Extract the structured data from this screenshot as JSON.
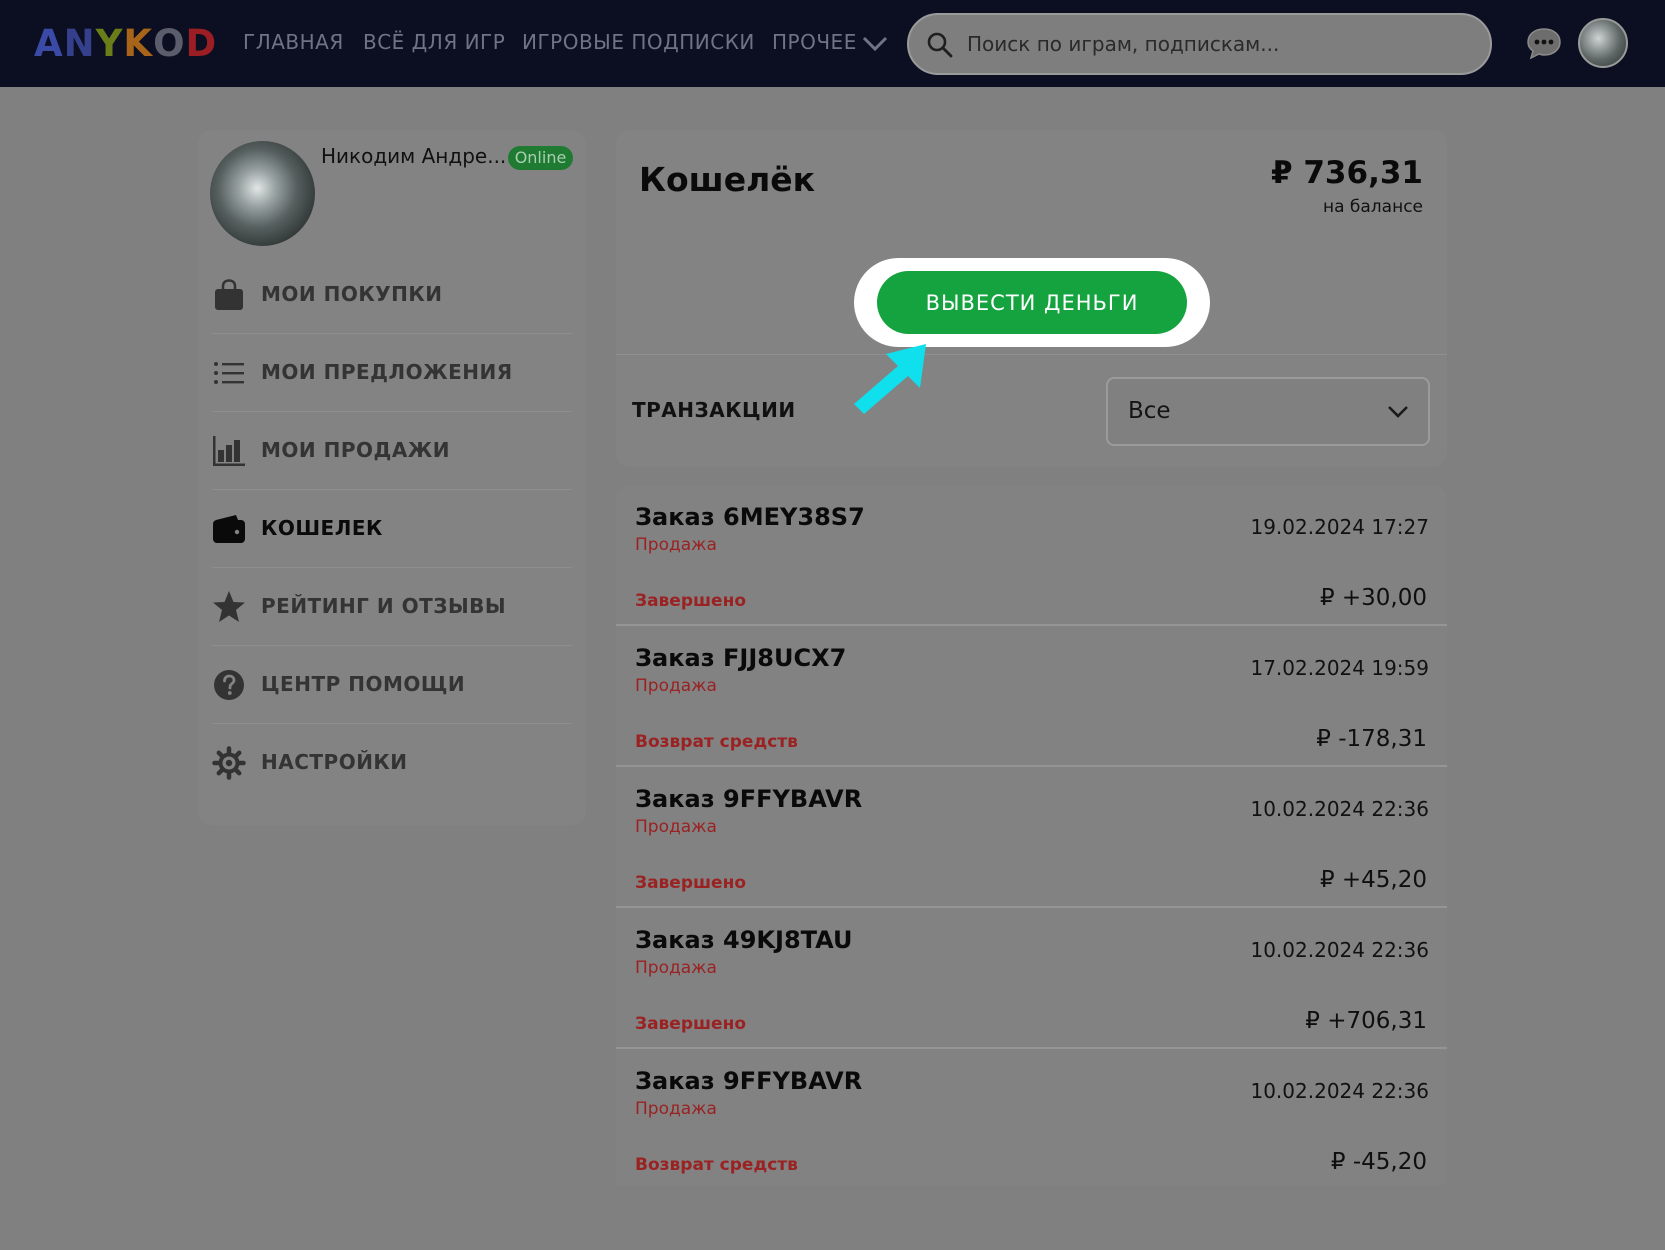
{
  "brand": {
    "letters": [
      {
        "char": "A",
        "color": "#3a4aa6"
      },
      {
        "char": "N",
        "color": "#34408c"
      },
      {
        "char": "Y",
        "color": "#6a7d18"
      },
      {
        "char": "K",
        "color": "#a8651a"
      },
      {
        "char": "O",
        "color": "#5b5d6d"
      },
      {
        "char": "D",
        "color": "#9a1e23"
      }
    ]
  },
  "nav": {
    "home": "ГЛАВНАЯ",
    "games": "ВСЁ ДЛЯ ИГР",
    "subscriptions": "ИГРОВЫЕ ПОДПИСКИ",
    "more": "ПРОЧЕЕ"
  },
  "search": {
    "placeholder": "Поиск по играм, подпискам..."
  },
  "icons": {
    "search": "search-icon",
    "chevron": "chevron-down-icon",
    "chat": "chat-bubble-icon",
    "bag": "shopping-bag-icon",
    "list": "list-icon",
    "chart": "bar-chart-icon",
    "wallet": "wallet-icon",
    "star": "star-icon",
    "help": "question-icon",
    "settings": "gear-icon",
    "pointer": "arrow-pointer-icon"
  },
  "profile": {
    "name": "Никодим Андре...",
    "status": "Online"
  },
  "menu": {
    "items": [
      {
        "label": "МОИ ПОКУПКИ",
        "active": false
      },
      {
        "label": "МОИ ПРЕДЛОЖЕНИЯ",
        "active": false
      },
      {
        "label": "МОИ ПРОДАЖИ",
        "active": false
      },
      {
        "label": "КОШЕЛЕК",
        "active": true
      },
      {
        "label": "РЕЙТИНГ И ОТЗЫВЫ",
        "active": false
      },
      {
        "label": "ЦЕНТР ПОМОЩИ",
        "active": false
      },
      {
        "label": "НАСТРОЙКИ",
        "active": false
      }
    ]
  },
  "wallet": {
    "title": "Кошелёк",
    "balance": "₽ 736,31",
    "balance_caption": "на балансе",
    "withdraw_label": "ВЫВЕСТИ ДЕНЬГИ",
    "transactions_label": "ТРАНЗАКЦИИ",
    "filter_value": "Все"
  },
  "transactions": [
    {
      "order": "Заказ 6MEY38S7",
      "type": "Продажа",
      "date": "19.02.2024 17:27",
      "status": "Завершено",
      "amount": "₽ +30,00"
    },
    {
      "order": "Заказ FJJ8UCX7",
      "type": "Продажа",
      "date": "17.02.2024 19:59",
      "status": "Возврат средств",
      "amount": "₽ -178,31"
    },
    {
      "order": "Заказ 9FFYBAVR",
      "type": "Продажа",
      "date": "10.02.2024 22:36",
      "status": "Завершено",
      "amount": "₽ +45,20"
    },
    {
      "order": "Заказ 49KJ8TAU",
      "type": "Продажа",
      "date": "10.02.2024 22:36",
      "status": "Завершено",
      "amount": "₽ +706,31"
    },
    {
      "order": "Заказ 9FFYBAVR",
      "type": "Продажа",
      "date": "10.02.2024 22:36",
      "status": "Возврат средств",
      "amount": "₽ -45,20"
    }
  ],
  "colors": {
    "header_bg": "#0c0f21",
    "page_overlay": "#808080",
    "accent_green": "#15a33f",
    "status_red": "#9a2222",
    "pointer_cyan": "#10e0ee"
  }
}
